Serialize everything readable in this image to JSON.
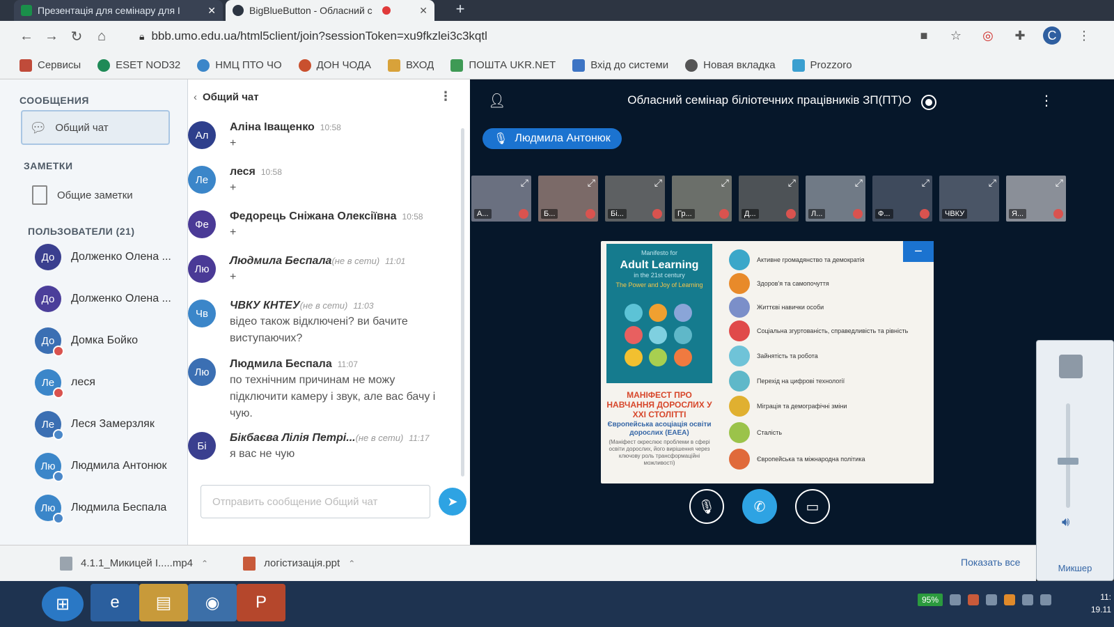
{
  "browser": {
    "tabs": [
      {
        "title": "Презентація для семінару для I"
      },
      {
        "title": "BigBlueButton - Обласний с"
      }
    ],
    "new_tab": "+",
    "url": "bbb.umo.edu.ua/html5client/join?sessionToken=xu9fkzlei3c3kqtl",
    "profile_initial": "C",
    "bookmarks": [
      "Сервисы",
      "ESET NOD32",
      "НМЦ ПТО ЧО",
      "ДОН ЧОДА",
      "ВХОД",
      "ПОШТА UKR.NET",
      "Вхід до системи",
      "Новая вкладка",
      "Prozzoro"
    ]
  },
  "sidebar": {
    "messages_header": "СООБЩЕНИЯ",
    "public_chat": "Общий чат",
    "notes_header": "ЗАМЕТКИ",
    "shared_notes": "Общие заметки",
    "users_header": "ПОЛЬЗОВАТЕЛИ (21)",
    "users": [
      {
        "initials": "До",
        "name": "Долженко Олена ...",
        "color": "#3a3f8f",
        "badge": ""
      },
      {
        "initials": "До",
        "name": "Долженко Олена ...",
        "color": "#4b3e9a",
        "badge": ""
      },
      {
        "initials": "До",
        "name": "Домка Бойко",
        "color": "#3b6fb3",
        "badge": "red"
      },
      {
        "initials": "Ле",
        "name": "леся",
        "color": "#3b86c9",
        "badge": "red"
      },
      {
        "initials": "Ле",
        "name": "Леся Замерзляк",
        "color": "#3b6fb3",
        "badge": "blue"
      },
      {
        "initials": "Лю",
        "name": "Людмила Антонюк",
        "color": "#3b86c9",
        "badge": "blue"
      },
      {
        "initials": "Лю",
        "name": "Людмила Беспала",
        "color": "#3b86c9",
        "badge": "blue"
      }
    ]
  },
  "chat": {
    "title": "Общий чат",
    "messages": [
      {
        "initials": "Ал",
        "name": "Аліна Іващенко",
        "status": "",
        "time": "10:58",
        "text": "+",
        "color": "#2e3f8c"
      },
      {
        "initials": "Ле",
        "name": "леся",
        "status": "",
        "time": "10:58",
        "text": "+",
        "color": "#3b86c9"
      },
      {
        "initials": "Фе",
        "name": "Федорець Сніжана Олексіївна",
        "status": "",
        "time": "10:58",
        "text": "+",
        "color": "#4a3a96"
      },
      {
        "initials": "Лю",
        "name": "Людмила Беспала",
        "status": "(не в сети)",
        "time": "11:01",
        "text": "+",
        "color": "#4a3a96"
      },
      {
        "initials": "Чв",
        "name": "ЧВКУ КНТЕУ",
        "status": "(не в сети)",
        "time": "11:03",
        "text": "відео також відключені? ви бачите виступаючих?",
        "color": "#3b86c9"
      },
      {
        "initials": "Лю",
        "name": "Людмила Беспала",
        "status": "",
        "time": "11:07",
        "text": "по технічним причинам не можу підключити камеру і звук, але вас бачу і чую.",
        "color": "#3b6fb3"
      },
      {
        "initials": "Бі",
        "name": "Бікбаєва Лілія Петрі...",
        "status": "(не в сети)",
        "time": "11:17",
        "text": "я вас не чую",
        "color": "#3a3f8f"
      }
    ],
    "input_placeholder": "Отправить сообщение Общий чат"
  },
  "main": {
    "meeting_title": "Обласний семінар біліотечних працівників ЗП(ПТ)О",
    "presenter": "Людмила Антонюк",
    "videos": [
      {
        "label": "А..."
      },
      {
        "label": "Б..."
      },
      {
        "label": "Бі..."
      },
      {
        "label": "Гр..."
      },
      {
        "label": "Д..."
      },
      {
        "label": "Л..."
      },
      {
        "label": "Ф..."
      },
      {
        "label": "ЧВКУ"
      },
      {
        "label": "Я..."
      }
    ],
    "slide": {
      "cover_small": "Manifesto for",
      "cover_title": "Adult Learning",
      "cover_century": "in the 21st century",
      "cover_sub": "The Power and Joy of Learning",
      "manifest_title": "МАНІФЕСТ ПРО НАВЧАННЯ ДОРОСЛИХ У XXI СТОЛІТТІ",
      "manifest_org": "Європейська асоціація освіти дорослих (EAEA)",
      "manifest_note": "(Маніфест окреслює проблеми в сфері освіти дорослих, його вирішення через ключову роль трансформаційні можливості)",
      "topics": [
        {
          "text": "Активне громадянство та демократія",
          "color": "#3ba7c9"
        },
        {
          "text": "Здоров'я та самопочуття",
          "color": "#e88a2a"
        },
        {
          "text": "Життєві навички особи",
          "color": "#7b8fc9"
        },
        {
          "text": "Соціальна згуртованість, справедливість та рівність",
          "color": "#e04a4a"
        },
        {
          "text": "Зайнятість та робота",
          "color": "#6fc3d8"
        },
        {
          "text": "Перехід на цифрові технології",
          "color": "#5fb8c9"
        },
        {
          "text": "Міграція та демографічні зміни",
          "color": "#e0b030"
        },
        {
          "text": "Сталість",
          "color": "#9bc34a"
        },
        {
          "text": "Європейська та міжнародна політика",
          "color": "#e06a3a"
        }
      ]
    }
  },
  "mixer": {
    "label": "Микшер"
  },
  "downloads": {
    "items": [
      "4.1.1_Микицей І.....mp4",
      "логістизація.ppt"
    ],
    "show_all": "Показать все"
  },
  "taskbar": {
    "battery": "95%",
    "clock_time": "11:",
    "clock_date": "19.11"
  }
}
